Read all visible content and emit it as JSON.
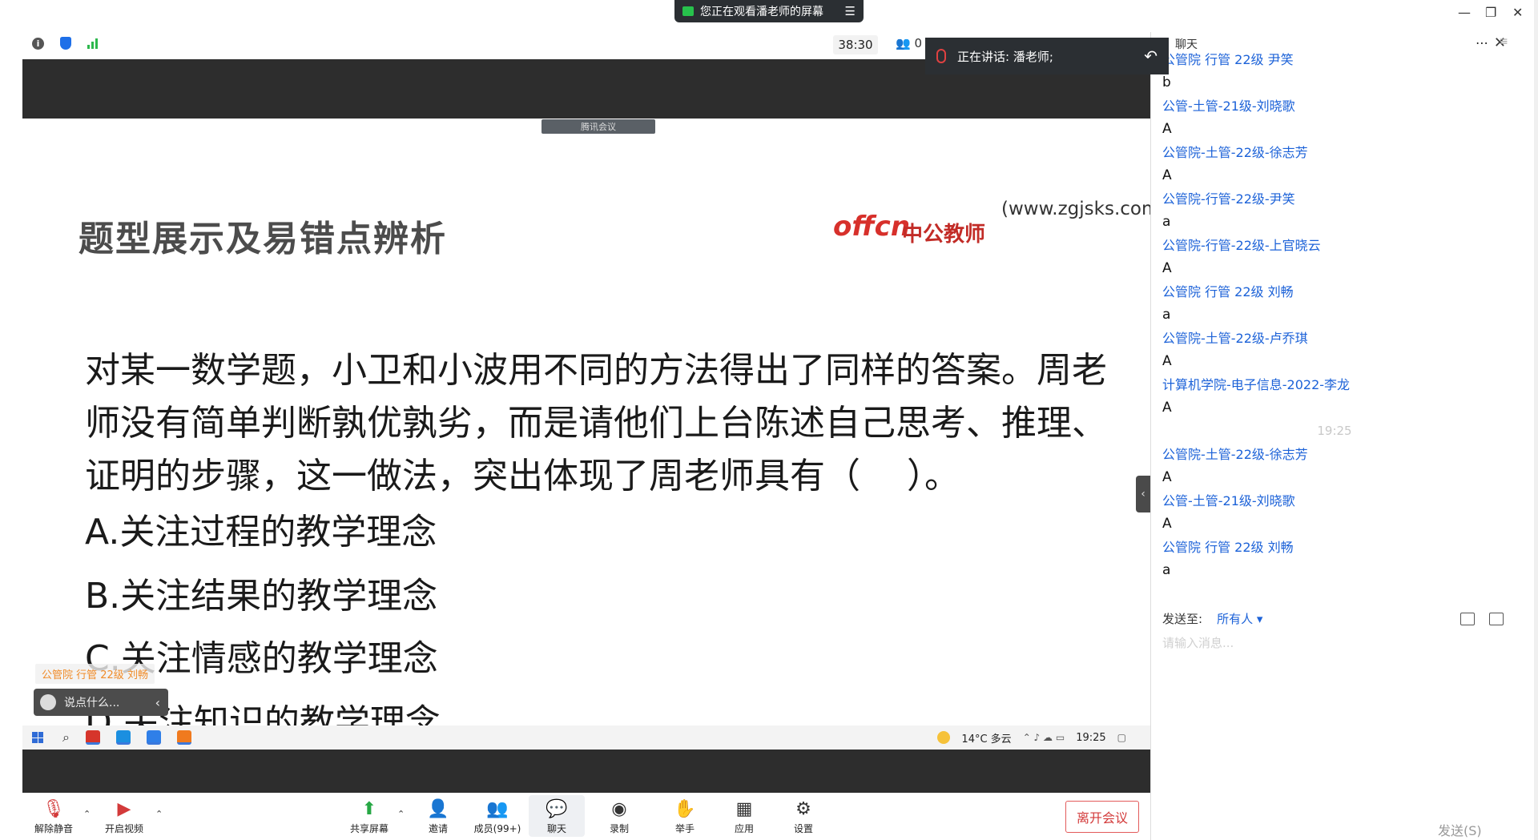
{
  "topbar": {
    "share_banner": "您正在观看潘老师的屏幕",
    "timer": "38:30",
    "participants": "0",
    "speaking": "正在讲话: 潘老师;",
    "controls": {
      "minimize": "—",
      "restore": "❐",
      "close": "✕"
    }
  },
  "slide": {
    "tag": "腾讯会议",
    "title": "题型展示及易错点辨析",
    "logo_latin": "offcn",
    "logo_cn": "中公教师",
    "url": "(www.zgjsks.com)",
    "question": "对某一数学题，小卫和小波用不同的方法得出了同样的答案。周老师没有简单判断孰优孰劣，而是请他们上台陈述自己思考、推理、证明的步骤，这一做法，突出体现了周老师具有（　 ）。",
    "options": [
      "A.关注过程的教学理念",
      "B.关注结果的教学理念",
      "C.关注情感的教学理念",
      "D.关注知识的教学理念"
    ],
    "floating_name": "公管院 行管 22级 刘畅",
    "say_placeholder": "说点什么...",
    "taskbar": {
      "weather": "14°C 多云",
      "time": "19:25"
    }
  },
  "chat": {
    "title": "聊天",
    "messages": [
      {
        "type": "name",
        "text": "公管院 行管 22级 尹笑"
      },
      {
        "type": "text",
        "text": "b"
      },
      {
        "type": "name",
        "text": "公管-土管-21级-刘晓歌"
      },
      {
        "type": "text",
        "text": "A"
      },
      {
        "type": "name",
        "text": "公管院-土管-22级-徐志芳"
      },
      {
        "type": "text",
        "text": "A"
      },
      {
        "type": "name",
        "text": "公管院-行管-22级-尹笑"
      },
      {
        "type": "text",
        "text": "a"
      },
      {
        "type": "name",
        "text": "公管院-行管-22级-上官晓云"
      },
      {
        "type": "text",
        "text": "A"
      },
      {
        "type": "name",
        "text": "公管院 行管 22级 刘畅"
      },
      {
        "type": "text",
        "text": "a"
      },
      {
        "type": "name",
        "text": "公管院-土管-22级-卢乔琪"
      },
      {
        "type": "text",
        "text": "A"
      },
      {
        "type": "name",
        "text": "计算机学院-电子信息-2022-李龙"
      },
      {
        "type": "text",
        "text": "A"
      },
      {
        "type": "time",
        "text": "19:25"
      },
      {
        "type": "name",
        "text": "公管院-土管-22级-徐志芳"
      },
      {
        "type": "text",
        "text": "A"
      },
      {
        "type": "name",
        "text": "公管-土管-21级-刘晓歌"
      },
      {
        "type": "text",
        "text": "A"
      },
      {
        "type": "name",
        "text": "公管院 行管 22级 刘畅"
      },
      {
        "type": "text",
        "text": "a"
      }
    ],
    "send_to_label": "发送至:",
    "send_to_target": "所有人",
    "input_placeholder": "请输入消息...",
    "send_button": "发送(S)"
  },
  "toolbar": {
    "unmute": "解除静音",
    "start_video": "开启视频",
    "share_screen": "共享屏幕",
    "invite": "邀请",
    "members": "成员(99+)",
    "chat": "聊天",
    "record": "录制",
    "raise_hand": "举手",
    "apps": "应用",
    "settings": "设置",
    "leave": "离开会议"
  },
  "colors": {
    "accent_blue": "#1c62d8",
    "leave_red": "#d33a3a",
    "share_green": "#27c24c"
  }
}
